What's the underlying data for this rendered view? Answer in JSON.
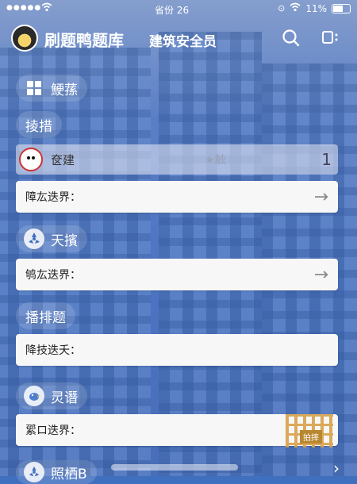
{
  "status_bar": {
    "carrier_dots": "●●●●●",
    "time": "省份 26",
    "battery": "11%"
  },
  "header": {
    "app_title": "刷题鸭题库",
    "subtitle": "建筑安全员",
    "search_icon": "search-icon",
    "menu_icon": "menu-icon"
  },
  "sections": [
    {
      "label": "鯁蓀"
    },
    {
      "label": "掕措"
    }
  ],
  "user_row": {
    "name": "奁建",
    "middle": "★触",
    "count": "1"
  },
  "cards": [
    {
      "label": "障厷迭界："
    },
    {
      "label": "鸲厷迭界："
    },
    {
      "label": "降技迭夭："
    },
    {
      "label": "綤ロ迭界："
    }
  ],
  "groups": [
    {
      "label": "天擯"
    },
    {
      "label": "播排题"
    },
    {
      "label": "灵谮"
    },
    {
      "label": "照栖B"
    }
  ],
  "badge_text": "拍摔",
  "colors": {
    "background": "#3f6fbf",
    "card": "#f7f7f7",
    "text": "#ffffff"
  }
}
